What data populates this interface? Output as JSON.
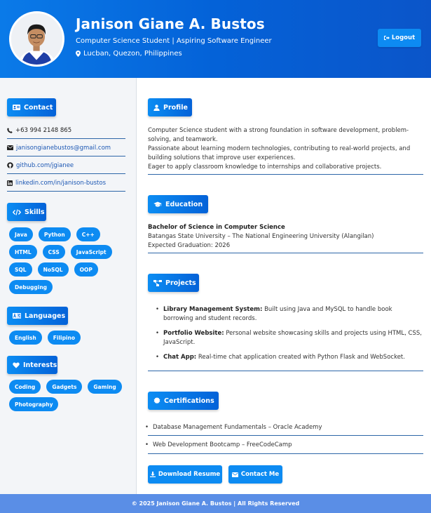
{
  "header": {
    "name": "Janison Giane A. Bustos",
    "title": "Computer Science Student | Aspiring Software Engineer",
    "location": "Lucban, Quezon, Philippines",
    "logout_label": "Logout"
  },
  "sidebar": {
    "contact": {
      "heading": "Contact",
      "phone": "+63 994 2148 865",
      "email": "janisongianebustos@gmail.com",
      "github": "github.com/jgianee",
      "linkedin": "linkedin.com/in/janison-bustos"
    },
    "skills": {
      "heading": "Skills",
      "items": [
        "Java",
        "Python",
        "C++",
        "HTML",
        "CSS",
        "JavaScript",
        "SQL",
        "NoSQL",
        "OOP",
        "Debugging"
      ]
    },
    "languages": {
      "heading": "Languages",
      "items": [
        "English",
        "Filipino"
      ]
    },
    "interests": {
      "heading": "Interests",
      "items": [
        "Coding",
        "Gadgets",
        "Gaming",
        "Photography"
      ]
    }
  },
  "main": {
    "profile": {
      "heading": "Profile",
      "lines": [
        "Computer Science student with a strong foundation in software development, problem-solving, and teamwork.",
        "Passionate about learning modern technologies, contributing to real-world projects, and building solutions that improve user experiences.",
        "Eager to apply classroom knowledge to internships and collaborative projects."
      ]
    },
    "education": {
      "heading": "Education",
      "degree": "Bachelor of Science in Computer Science",
      "school": "Batangas State University – The National Engineering University (Alangilan)",
      "graduation": "Expected Graduation: 2026"
    },
    "projects": {
      "heading": "Projects",
      "items": [
        {
          "name": "Library Management System:",
          "desc": " Built using Java and MySQL to handle book borrowing and student records."
        },
        {
          "name": "Portfolio Website:",
          "desc": " Personal website showcasing skills and projects using HTML, CSS, JavaScript."
        },
        {
          "name": "Chat App:",
          "desc": " Real-time chat application created with Python Flask and WebSocket."
        }
      ]
    },
    "certifications": {
      "heading": "Certifications",
      "items": [
        "Database Management Fundamentals – Oracle Academy",
        "Web Development Bootcamp – FreeCodeCamp"
      ]
    },
    "actions": {
      "download_label": "Download Resume",
      "contact_label": "Contact Me"
    }
  },
  "footer": {
    "text": "© 2025 Janison Giane A. Bustos | All Rights Reserved"
  },
  "colors": {
    "header_start": "#0a7ae8",
    "header_end": "#0b55c9",
    "accent": "#0d8bf2",
    "rule": "#2d66a8",
    "sidebar_bg": "#f3f5f8",
    "footer_bg": "#5a8ee6"
  },
  "icons": {
    "location": "map-pin-icon",
    "logout": "sign-out-icon",
    "contact": "id-card-icon",
    "phone": "phone-icon",
    "email": "envelope-icon",
    "github": "github-icon",
    "linkedin": "linkedin-icon",
    "skills": "code-icon",
    "languages": "language-icon",
    "interests": "heart-icon",
    "profile": "user-icon",
    "education": "graduation-cap-icon",
    "projects": "project-diagram-icon",
    "certifications": "certificate-icon",
    "download": "download-icon",
    "contact_me": "envelope-icon"
  }
}
